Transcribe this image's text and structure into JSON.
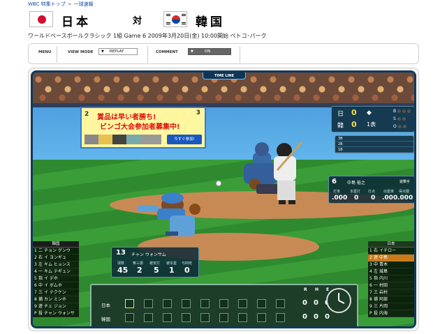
{
  "breadcrumb": {
    "home": "WBC 特集トップ",
    "sep": ">",
    "current": "一球速報"
  },
  "header": {
    "home_team": "日本",
    "vs": "対",
    "away_team": "韓国",
    "subtitle": "ワールドベースボールクラシック 1組 Game 6 2009年3月20日(金) 10:00開始 ペトコ･パーク"
  },
  "menubar": {
    "menu_label": "MENU",
    "view_mode_label": "VIEW MODE",
    "view_mode_value": "REPLAY",
    "comment_label": "COMMENT",
    "comment_value": "ON"
  },
  "game": {
    "timeline_label": "TIME LINE",
    "ad": {
      "line1": "賞品は早い者勝ち!",
      "line2": "ビンゴ大会参加者募集中!",
      "button": "今すぐ参加!",
      "num_left": "2",
      "num_right": "3"
    },
    "score": {
      "home_short": "日",
      "away_short": "韓",
      "home_runs": "0",
      "away_runs": "0",
      "inning": "1表",
      "balls_label": "B",
      "strikes_label": "S",
      "outs_label": "O"
    },
    "log": [
      "3B",
      "2B",
      "1B"
    ],
    "batter": {
      "number": "6",
      "name": "中島 裕之",
      "position": "遊撃手",
      "stats": [
        {
          "label": "打率",
          "value": ".000"
        },
        {
          "label": "本塁打",
          "value": "0"
        },
        {
          "label": "打点",
          "value": "0"
        },
        {
          "label": "出塁率",
          "value": ".000"
        },
        {
          "label": "得点圏",
          "value": ".000"
        }
      ]
    },
    "pitcher": {
      "number": "13",
      "name": "チャン ウォンサム",
      "stats": [
        {
          "label": "球数",
          "value": "45"
        },
        {
          "label": "奪三振",
          "value": "2"
        },
        {
          "label": "被安打",
          "value": "5"
        },
        {
          "label": "被本塁",
          "value": "1"
        },
        {
          "label": "与四死",
          "value": "0"
        }
      ]
    },
    "lineup_korea": {
      "title": "韓国",
      "rows": [
        {
          "order": "1",
          "pos": "二",
          "name": "チョン グンウ"
        },
        {
          "order": "2",
          "pos": "右",
          "name": "イ ヨンギュ"
        },
        {
          "order": "3",
          "pos": "左",
          "name": "キム ヒョンス"
        },
        {
          "order": "4",
          "pos": "一",
          "name": "キム テギュン"
        },
        {
          "order": "5",
          "pos": "指",
          "name": "イ デホ"
        },
        {
          "order": "6",
          "pos": "中",
          "name": "イ ボムホ"
        },
        {
          "order": "7",
          "pos": "三",
          "name": "イ テクケン"
        },
        {
          "order": "8",
          "pos": "捕",
          "name": "カン ミンホ"
        },
        {
          "order": "9",
          "pos": "遊",
          "name": "チェ ジョン"
        },
        {
          "order": "P",
          "pos": "投",
          "name": "チャン ウォンサ"
        }
      ]
    },
    "lineup_japan": {
      "title": "日本",
      "rows": [
        {
          "order": "1",
          "pos": "右",
          "name": "イチロー"
        },
        {
          "order": "2",
          "pos": "遊",
          "name": "中島"
        },
        {
          "order": "3",
          "pos": "中",
          "name": "青木"
        },
        {
          "order": "4",
          "pos": "左",
          "name": "城島"
        },
        {
          "order": "5",
          "pos": "指",
          "name": "内川"
        },
        {
          "order": "6",
          "pos": "一",
          "name": "村田"
        },
        {
          "order": "7",
          "pos": "三",
          "name": "岩村"
        },
        {
          "order": "8",
          "pos": "捕",
          "name": "阿部"
        },
        {
          "order": "9",
          "pos": "三",
          "name": "片岡"
        },
        {
          "order": "P",
          "pos": "投",
          "name": "内海"
        }
      ]
    },
    "scoreboard": {
      "home_label": "日本",
      "away_label": "韓国",
      "cols": [
        "R",
        "H",
        "E"
      ],
      "home_rhe": [
        "0",
        "0",
        "0"
      ],
      "away_rhe": [
        "0",
        "0",
        "0"
      ]
    }
  }
}
